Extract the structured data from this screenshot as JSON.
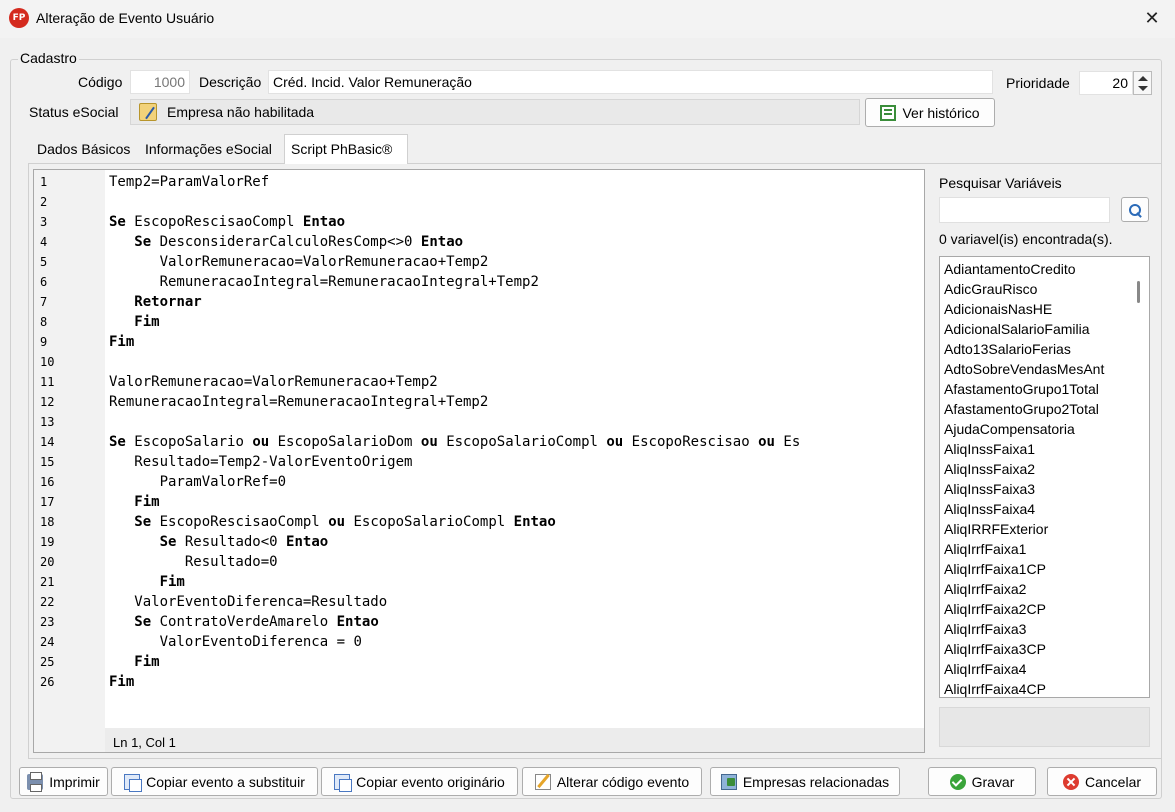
{
  "window": {
    "title": "Alteração de Evento Usuário",
    "app_icon_text": "FP",
    "close_glyph": "✕"
  },
  "cadastro": {
    "group_label": "Cadastro",
    "codigo_label": "Código",
    "codigo_value": "1000",
    "descricao_label": "Descrição",
    "descricao_value": "Créd. Incid. Valor Remuneração",
    "prioridade_label": "Prioridade",
    "prioridade_value": "20",
    "status_label": "Status eSocial",
    "status_value": "Empresa não habilitada",
    "ver_historico_label": "Ver histórico"
  },
  "tabs": [
    {
      "label": "Dados Básicos",
      "active": false
    },
    {
      "label": "Informações eSocial",
      "active": false
    },
    {
      "label": "Script PhBasic®",
      "active": true
    }
  ],
  "editor": {
    "lines": [
      "Temp2=ParamValorRef",
      "",
      "Se EscopoRescisaoCompl Entao",
      "   Se DesconsiderarCalculoResComp<>0 Entao",
      "      ValorRemuneracao=ValorRemuneracao+Temp2",
      "      RemuneracaoIntegral=RemuneracaoIntegral+Temp2",
      "   Retornar",
      "   Fim",
      "Fim",
      "",
      "ValorRemuneracao=ValorRemuneracao+Temp2",
      "RemuneracaoIntegral=RemuneracaoIntegral+Temp2",
      "",
      "Se EscopoSalario ou EscopoSalarioDom ou EscopoSalarioCompl ou EscopoRescisao ou Es",
      "   Resultado=Temp2-ValorEventoOrigem",
      "      ParamValorRef=0",
      "   Fim",
      "   Se EscopoRescisaoCompl ou EscopoSalarioCompl Entao",
      "      Se Resultado<0 Entao",
      "         Resultado=0",
      "      Fim",
      "   ValorEventoDiferenca=Resultado",
      "   Se ContratoVerdeAmarelo Entao",
      "      ValorEventoDiferenca = 0",
      "   Fim",
      "Fim"
    ],
    "line_numbers": [
      "1",
      "2",
      "3",
      "4",
      "5",
      "6",
      "7",
      "8",
      "9",
      "10",
      "11",
      "12",
      "13",
      "14",
      "15",
      "16",
      "17",
      "18",
      "19",
      "20",
      "21",
      "22",
      "23",
      "24",
      "25",
      "26"
    ],
    "keywords": [
      "Se",
      "Entao",
      "Fim",
      "Retornar",
      "ou"
    ],
    "cursor_status": "Ln 1, Col 1"
  },
  "variables_panel": {
    "search_label": "Pesquisar Variáveis",
    "search_value": "",
    "found_text": "0 variavel(is) encontrada(s).",
    "items": [
      "AdiantamentoCredito",
      "AdicGrauRisco",
      "AdicionaisNasHE",
      "AdicionalSalarioFamilia",
      "Adto13SalarioFerias",
      "AdtoSobreVendasMesAnt",
      "AfastamentoGrupo1Total",
      "AfastamentoGrupo2Total",
      "AjudaCompensatoria",
      "AliqInssFaixa1",
      "AliqInssFaixa2",
      "AliqInssFaixa3",
      "AliqInssFaixa4",
      "AliqIRRFExterior",
      "AliqIrrfFaixa1",
      "AliqIrrfFaixa1CP",
      "AliqIrrfFaixa2",
      "AliqIrrfFaixa2CP",
      "AliqIrrfFaixa3",
      "AliqIrrfFaixa3CP",
      "AliqIrrfFaixa4",
      "AliqIrrfFaixa4CP"
    ]
  },
  "footer": {
    "imprimir": "Imprimir",
    "copiar_substituir": "Copiar evento a substituir",
    "copiar_originario": "Copiar evento originário",
    "alterar_codigo": "Alterar código evento",
    "empresas_relacionadas": "Empresas relacionadas",
    "gravar": "Gravar",
    "cancelar": "Cancelar"
  }
}
